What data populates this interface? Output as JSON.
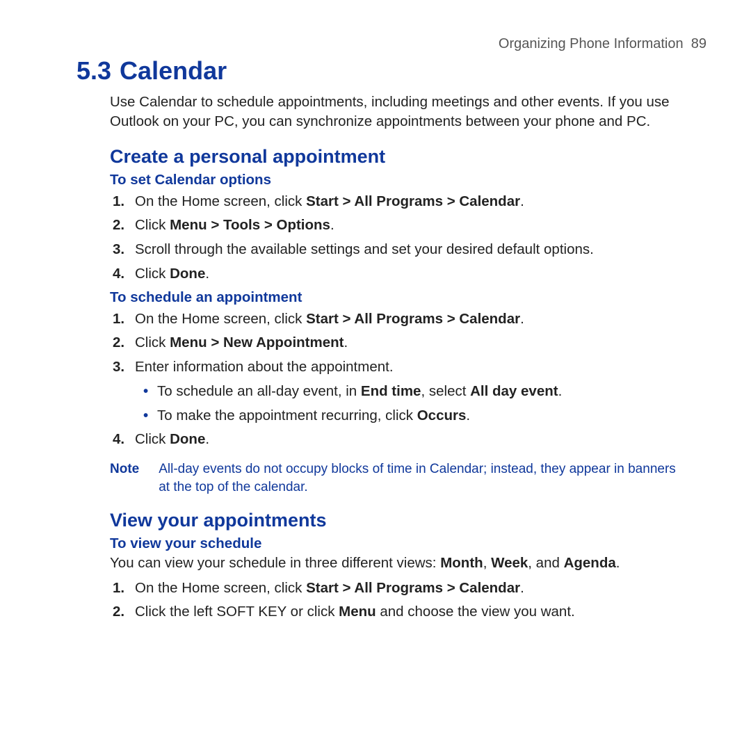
{
  "runhead": {
    "title": "Organizing Phone Information",
    "page": "89"
  },
  "section": {
    "number": "5.3",
    "title": "Calendar"
  },
  "intro": "Use Calendar to schedule appointments, including meetings and other events. If you use Outlook on your PC, you can synchronize appointments between your phone and PC.",
  "sub_create": "Create a personal appointment",
  "subsub_set_options": "To set Calendar options",
  "steps_set_options": {
    "s1_a": "On the Home screen, click ",
    "s1_b": "Start > All Programs > Calendar",
    "s1_c": ".",
    "s2_a": "Click ",
    "s2_b": "Menu > Tools > Options",
    "s2_c": ".",
    "s3": "Scroll through the available settings and set your desired default options.",
    "s4_a": "Click ",
    "s4_b": "Done",
    "s4_c": "."
  },
  "subsub_schedule": "To schedule an appointment",
  "steps_schedule": {
    "s1_a": "On the Home screen, click ",
    "s1_b": "Start > All Programs > Calendar",
    "s1_c": ".",
    "s2_a": "Click ",
    "s2_b": "Menu > New Appointment",
    "s2_c": ".",
    "s3": "Enter information about the appointment.",
    "s3b1_a": "To schedule an all-day event, in ",
    "s3b1_b": "End time",
    "s3b1_c": ", select ",
    "s3b1_d": "All day event",
    "s3b1_e": ".",
    "s3b2_a": "To make the appointment recurring, click ",
    "s3b2_b": "Occurs",
    "s3b2_c": ".",
    "s4_a": "Click ",
    "s4_b": "Done",
    "s4_c": "."
  },
  "note": {
    "label": "Note",
    "text": "All-day events do not occupy blocks of time in Calendar; instead, they appear in banners at the top of the calendar."
  },
  "sub_view": "View your appointments",
  "subsub_view": "To view your schedule",
  "view_intro_a": "You can view your schedule in three different views: ",
  "view_intro_b": "Month",
  "view_intro_c": ", ",
  "view_intro_d": "Week",
  "view_intro_e": ", and ",
  "view_intro_f": "Agenda",
  "view_intro_g": ".",
  "steps_view": {
    "s1_a": "On the Home screen, click ",
    "s1_b": "Start > All Programs > Calendar",
    "s1_c": ".",
    "s2_a": "Click the left SOFT KEY or click ",
    "s2_b": "Menu",
    "s2_c": " and choose the view you want."
  }
}
